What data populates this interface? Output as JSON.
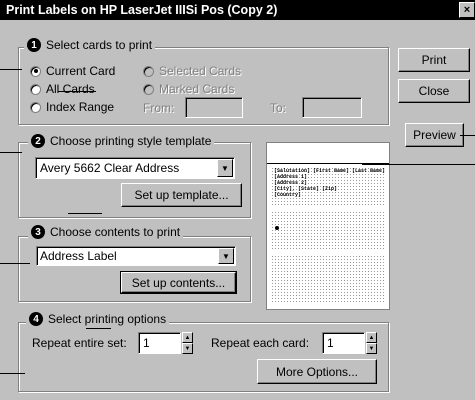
{
  "window": {
    "title": "Print Labels on HP LaserJet IIISi Pos (Copy 2)",
    "close_glyph": "×"
  },
  "colors": {
    "dialog_bg": "#c0c0c0",
    "titlebar_bg": "#000000",
    "preview_bg": "#ffffff"
  },
  "section1": {
    "number": "1",
    "label": "Select cards to print",
    "options": {
      "current": "Current Card",
      "all": "All Cards",
      "range": "Index Range",
      "selected": "Selected Cards",
      "marked": "Marked Cards"
    },
    "selected_option": "Current Card",
    "from_label": "From:",
    "to_label": "To:",
    "from_value": "",
    "to_value": ""
  },
  "section2": {
    "number": "2",
    "label": "Choose printing style template",
    "template_value": "Avery 5662 Clear Address",
    "setup_button": "Set up template..."
  },
  "section3": {
    "number": "3",
    "label": "Choose contents to print",
    "contents_value": "Address Label",
    "setup_button": "Set up contents..."
  },
  "section4": {
    "number": "4",
    "label": "Select printing options",
    "repeat_set_label": "Repeat entire set:",
    "repeat_set_value": "1",
    "repeat_card_label": "Repeat each card:",
    "repeat_card_value": "1",
    "more_button": "More Options..."
  },
  "buttons": {
    "print": "Print",
    "close": "Close",
    "preview": "Preview"
  },
  "preview_text": {
    "line1": "[Salutation] [First Name] [Last Name]",
    "line2": "[Address 1]",
    "line3": "[Address 2]",
    "line4": "[City], [State] [Zip]",
    "line5": "[Country]"
  }
}
